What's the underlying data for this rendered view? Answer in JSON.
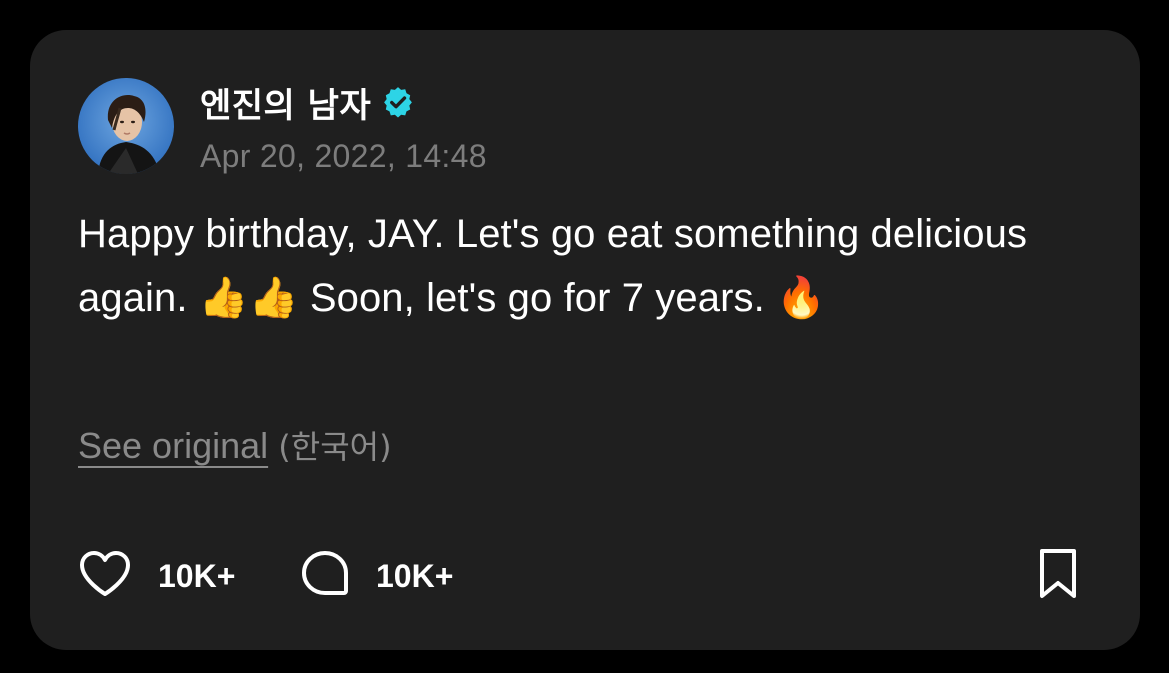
{
  "post": {
    "author": {
      "name": "엔진의 남자",
      "verified": true,
      "verified_color": "#2dd4e6",
      "avatar_icon": "avatar"
    },
    "timestamp": "Apr 20, 2022, 14:48",
    "body": "Happy birthday, JAY. Let's go eat something delicious again. 👍👍 Soon, let's go for 7 years. 🔥",
    "translation": {
      "link_label": "See original",
      "language": " (한국어)"
    }
  },
  "actions": {
    "likes": {
      "icon": "heart-icon",
      "count": "10K+"
    },
    "comments": {
      "icon": "comment-icon",
      "count": "10K+"
    },
    "bookmark": {
      "icon": "bookmark-icon"
    }
  },
  "colors": {
    "background": "#000000",
    "card": "#1f1f1f",
    "text": "#ffffff",
    "muted": "#7d7d7d"
  }
}
